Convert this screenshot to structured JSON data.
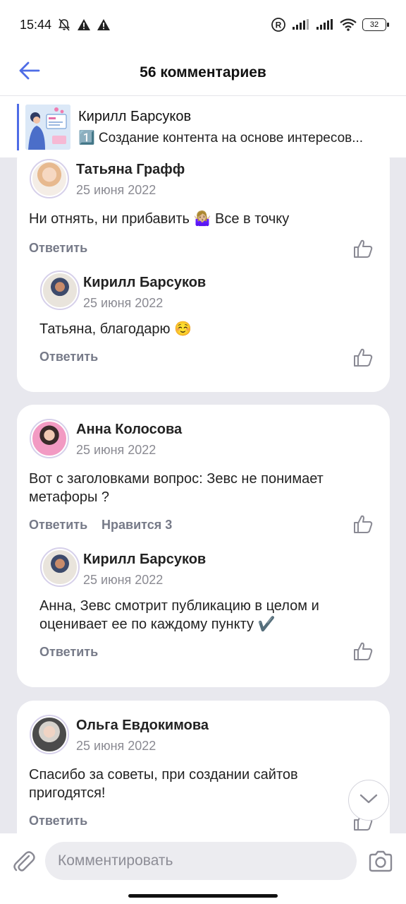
{
  "status_bar": {
    "time": "15:44",
    "battery": "32",
    "icons": [
      "bell-off-icon",
      "warning-icon",
      "warning-icon",
      "registered-icon",
      "signal-icon",
      "signal-icon",
      "wifi-icon",
      "battery-icon"
    ]
  },
  "header": {
    "title": "56 комментариев",
    "back_icon": "arrow-left-icon",
    "accent_color": "#4e6ce6"
  },
  "post_ref": {
    "author": "Кирилл Барсуков",
    "snippet": "1️⃣ Создание контента на основе интересов..."
  },
  "comments": [
    {
      "author": "Татьяна  Графф",
      "date": "25 июня 2022",
      "text": "Ни отнять, ни прибавить 🤷🏼‍♀️ Все в точку",
      "reply_label": "Ответить",
      "reply": {
        "author": "Кирилл Барсуков",
        "date": "25 июня 2022",
        "text": "Татьяна, благодарю ☺️",
        "reply_label": "Ответить"
      }
    },
    {
      "author": "Анна Колосова",
      "date": "25 июня 2022",
      "text_line1": "Вот с заголовками вопрос: Зевс не понимает",
      "text_line2": "метафоры ?",
      "reply_label": "Ответить",
      "likes_label": "Нравится 3",
      "reply": {
        "author": "Кирилл Барсуков",
        "date": "25 июня 2022",
        "text_line1": "Анна, Зевс смотрит публикацию в целом и",
        "text_line2": "оценивает ее по каждому пункту ✔️",
        "reply_label": "Ответить"
      }
    },
    {
      "author": "Ольга Евдокимова",
      "date": "25 июня 2022",
      "text_line1": "Спасибо за советы, при создании сайтов",
      "text_line2": "пригодятся!",
      "reply_label": "Ответить"
    }
  ],
  "composer": {
    "placeholder": "Комментировать",
    "attach_icon": "paperclip-icon",
    "camera_icon": "camera-icon"
  },
  "scroll_down_icon": "chevron-down-icon"
}
